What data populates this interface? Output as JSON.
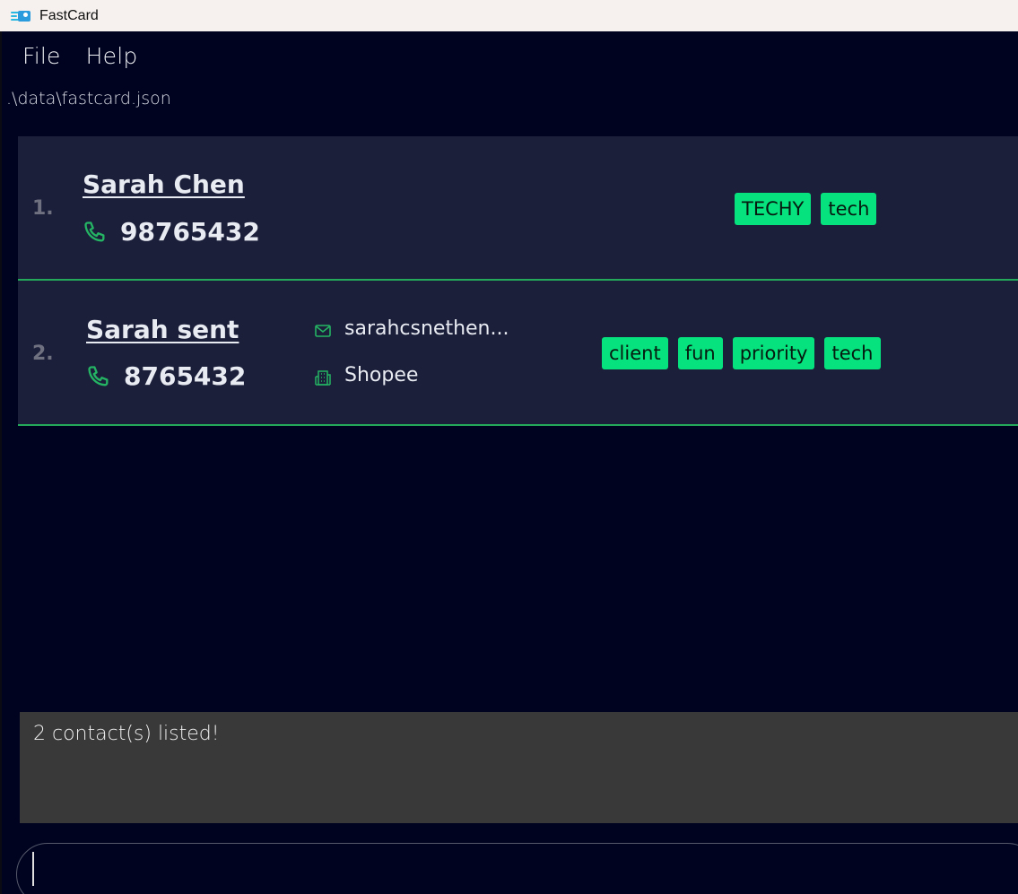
{
  "window": {
    "title": "FastCard",
    "icon": "contact-card-icon"
  },
  "menu": {
    "file": "File",
    "help": "Help"
  },
  "file_path": ".\\data\\fastcard.json",
  "contacts": [
    {
      "index": "1.",
      "name": "Sarah Chen",
      "phone": "98765432",
      "tags": [
        "TECHY",
        "tech"
      ]
    },
    {
      "index": "2.",
      "name": "Sarah sent",
      "phone": "8765432",
      "email": "sarahcsnethen...",
      "company": "Shopee",
      "tags": [
        "client",
        "fun",
        "priority",
        "tech"
      ]
    }
  ],
  "result_message": "2 contact(s) listed!",
  "command_input": {
    "value": "",
    "placeholder": ""
  },
  "colors": {
    "background": "#000320",
    "card": "#1b1f3a",
    "tag": "#06e27e",
    "accent": "#24a85a",
    "result_box": "#393939"
  }
}
